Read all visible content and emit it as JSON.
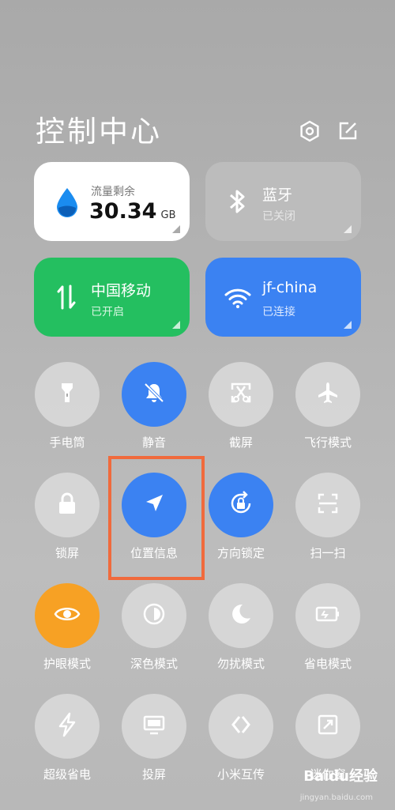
{
  "header": {
    "title": "控制中心",
    "settings_icon": "hexagon-gear-icon",
    "edit_icon": "edit-icon"
  },
  "tiles": {
    "data": {
      "label": "流量剩余",
      "value": "30.34",
      "unit": "GB",
      "icon": "water-drop-icon",
      "accent": "#1a8cf0"
    },
    "bluetooth": {
      "label": "蓝牙",
      "status": "已关闭",
      "icon": "bluetooth-icon"
    },
    "mobile": {
      "label": "中国移动",
      "status": "已开启",
      "icon": "data-arrows-icon",
      "color": "#24bf60"
    },
    "wifi": {
      "label": "jf-china",
      "status": "已连接",
      "icon": "wifi-icon",
      "color": "#3b82f2"
    }
  },
  "toggles": [
    {
      "label": "手电筒",
      "icon": "flashlight-icon",
      "active": false
    },
    {
      "label": "静音",
      "icon": "bell-off-icon",
      "active": true
    },
    {
      "label": "截屏",
      "icon": "screenshot-icon",
      "active": false
    },
    {
      "label": "飞行模式",
      "icon": "airplane-icon",
      "active": false
    },
    {
      "label": "锁屏",
      "icon": "lock-icon",
      "active": false
    },
    {
      "label": "位置信息",
      "icon": "location-arrow-icon",
      "active": true
    },
    {
      "label": "方向锁定",
      "icon": "rotation-lock-icon",
      "active": true
    },
    {
      "label": "扫一扫",
      "icon": "scan-icon",
      "active": false
    },
    {
      "label": "护眼模式",
      "icon": "eye-icon",
      "active": true
    },
    {
      "label": "深色模式",
      "icon": "dark-mode-icon",
      "active": false
    },
    {
      "label": "勿扰模式",
      "icon": "moon-icon",
      "active": false
    },
    {
      "label": "省电模式",
      "icon": "battery-icon",
      "active": false
    },
    {
      "label": "超级省电",
      "icon": "lightning-icon",
      "active": false
    },
    {
      "label": "投屏",
      "icon": "cast-screen-icon",
      "active": false
    },
    {
      "label": "小米互传",
      "icon": "share-icon",
      "active": false
    },
    {
      "label": "迷你窗",
      "icon": "mini-window-icon",
      "active": false
    }
  ],
  "watermark": {
    "text": "Baidu经验",
    "sub": "jingyan.baidu.com"
  }
}
